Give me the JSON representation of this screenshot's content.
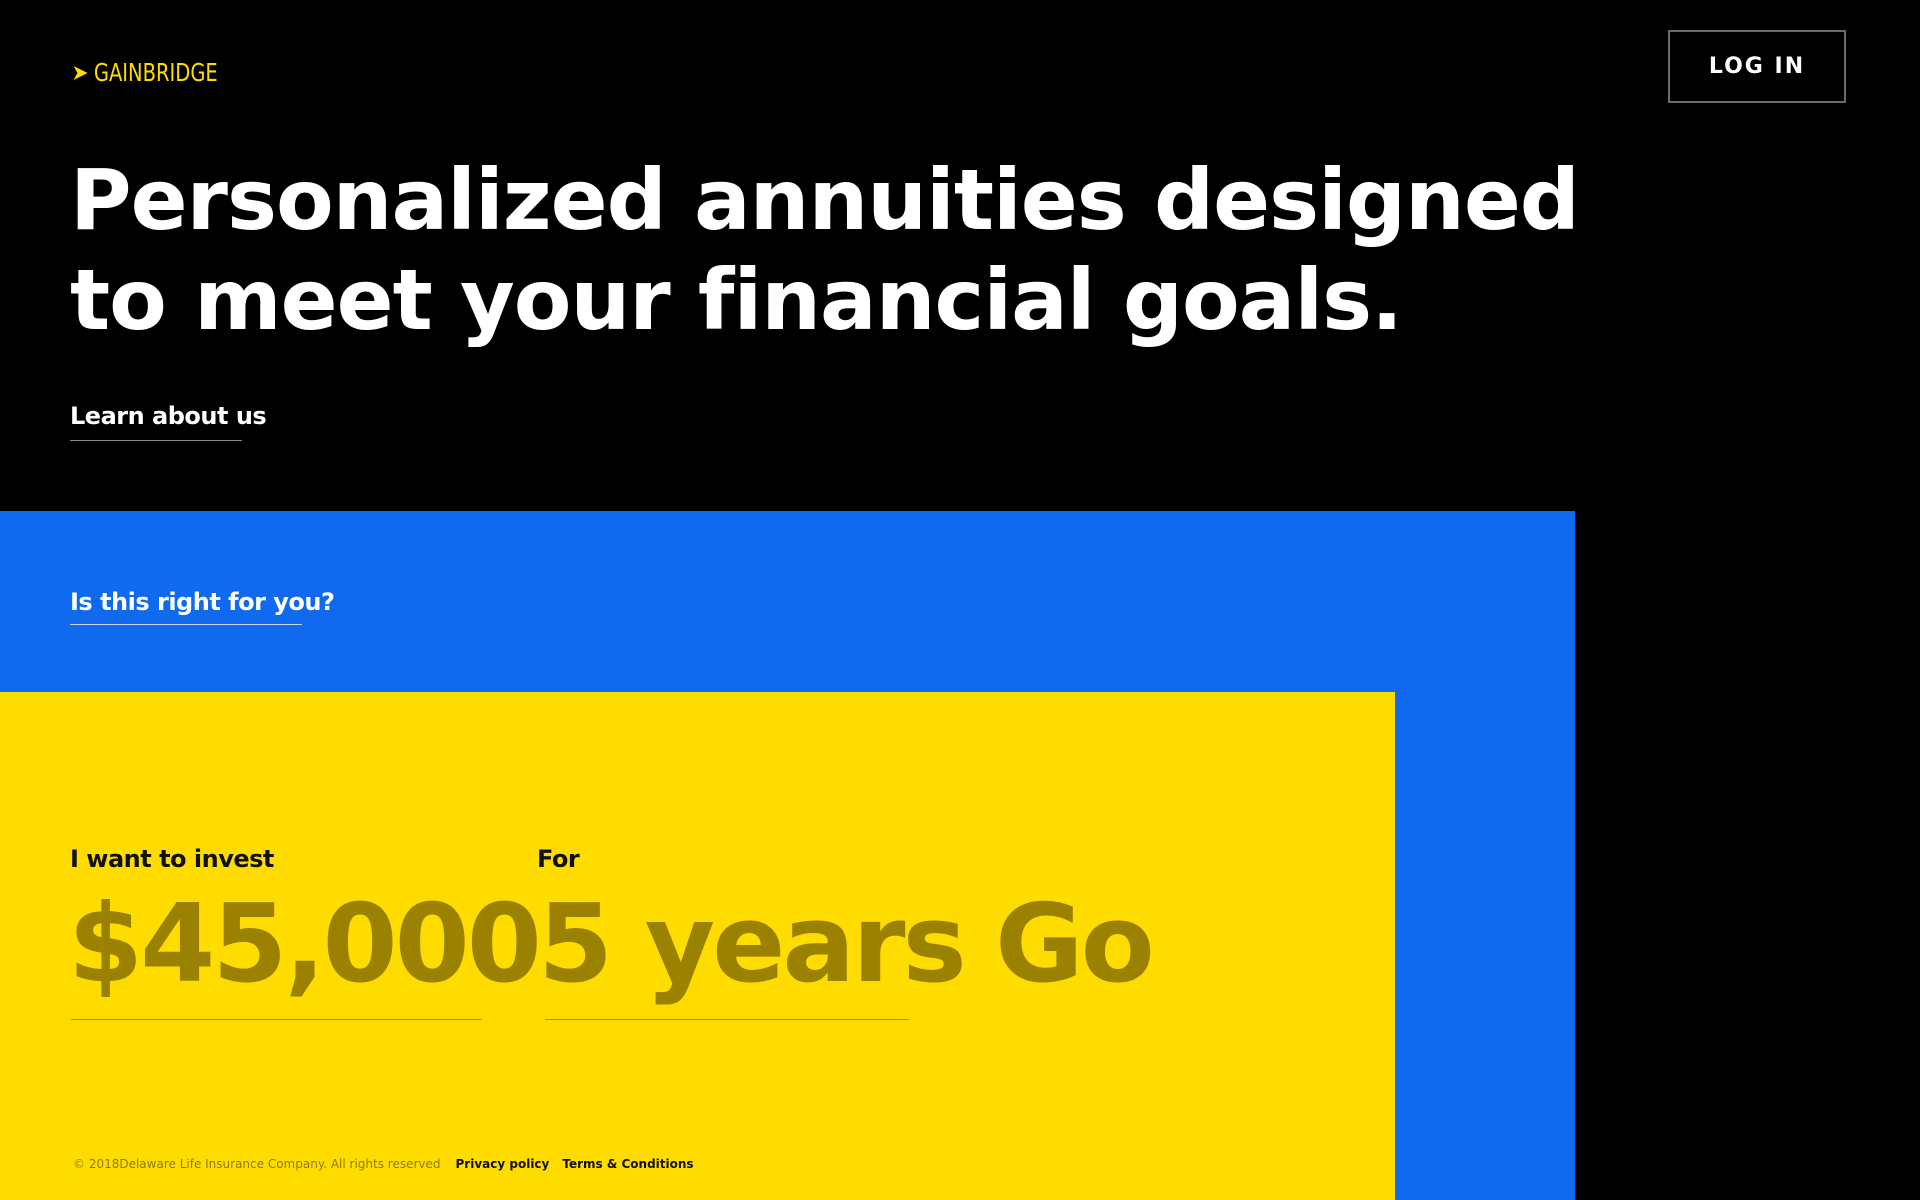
{
  "header": {
    "logo_text": "GAINBRIDGE",
    "login_label": "LOG IN"
  },
  "hero": {
    "title_line1": "Personalized annuities designed",
    "title_line2": "to meet your financial goals.",
    "learn_link": "Learn about us"
  },
  "qualify": {
    "link": "Is this right for you?"
  },
  "calculator": {
    "invest_label": "I want to invest",
    "invest_value": "$45,000",
    "term_label": "For",
    "term_value": "5 years",
    "go_label": "Go"
  },
  "footer": {
    "copyright": "© 2018Delaware Life Insurance Company. All rights reserved",
    "privacy": "Privacy policy",
    "terms": "Terms & Conditions"
  },
  "colors": {
    "background": "#000000",
    "accent_yellow": "#ffdc00",
    "accent_blue": "#0f6af0",
    "muted_gold": "#9a8200",
    "text_white": "#ffffff"
  },
  "icons": {
    "logo": "chevron-right-icon"
  }
}
